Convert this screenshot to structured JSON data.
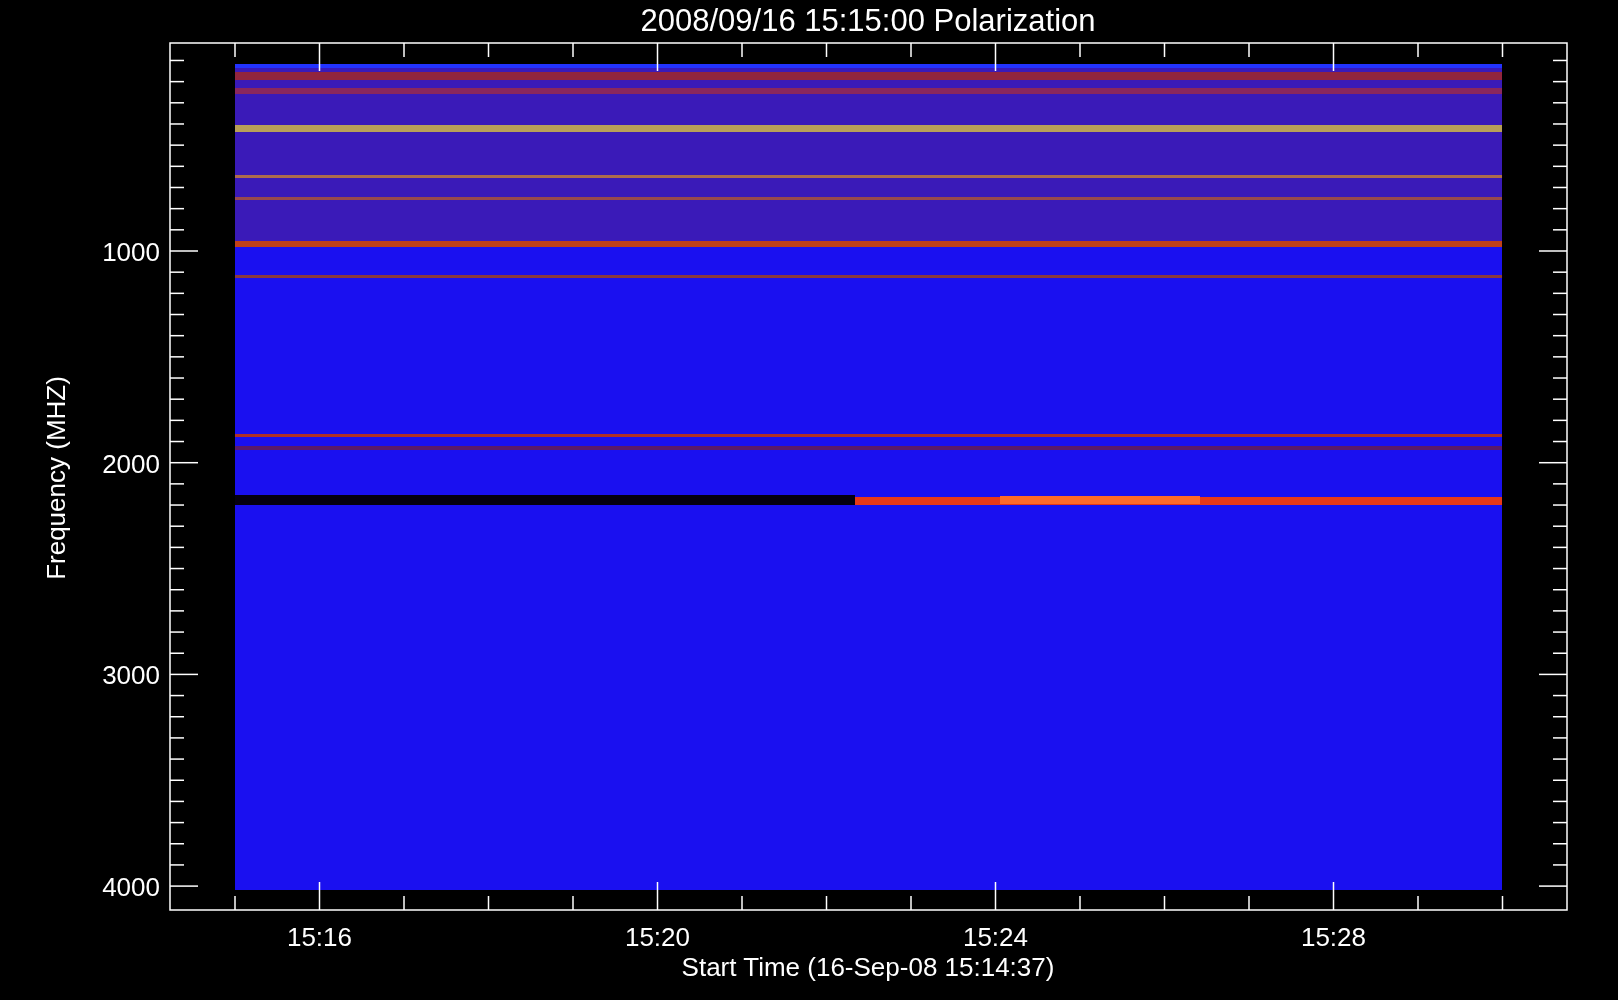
{
  "title": "2008/09/16 15:15:00 Polarization",
  "y_axis": {
    "label": "Frequency (MHZ)",
    "tick_labels": [
      "1000",
      "2000",
      "3000",
      "4000"
    ]
  },
  "x_axis": {
    "label": "Start Time (16-Sep-08 15:14:37)",
    "tick_labels": [
      "15:16",
      "15:20",
      "15:24",
      "15:28"
    ]
  }
}
